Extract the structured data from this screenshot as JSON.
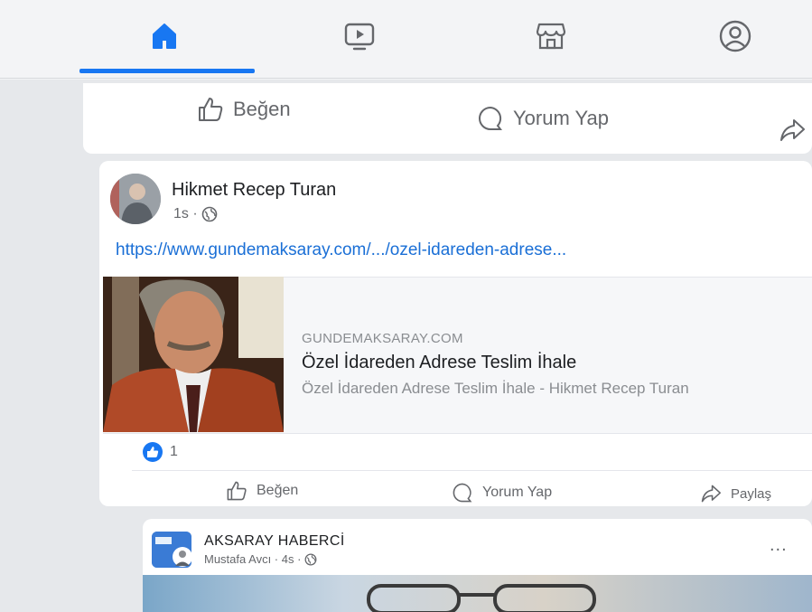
{
  "nav": {
    "tabs": [
      {
        "name": "home",
        "icon": "home-icon",
        "active": true
      },
      {
        "name": "watch",
        "icon": "video-icon",
        "active": false
      },
      {
        "name": "marketplace",
        "icon": "store-icon",
        "active": false
      },
      {
        "name": "profile",
        "icon": "profile-icon",
        "active": false
      }
    ],
    "accent_color": "#1877f2"
  },
  "top_actions": {
    "like_label": "Beğen",
    "comment_label": "Yorum Yap"
  },
  "post": {
    "author": "Hikmet Recep Turan",
    "time": "1s ·",
    "url_text": "https://www.gundemaksaray.com/.../ozel-idareden-adrese...",
    "preview": {
      "domain": "GUNDEMAKSARAY.COM",
      "title": "Özel İdareden Adrese Teslim İhale",
      "description": "Özel İdareden Adrese Teslim İhale - Hikmet Recep Turan"
    },
    "reaction_count": "1",
    "actions": {
      "like_label": "Beğen",
      "comment_label": "Yorum Yap",
      "share_label": "Paylaş"
    }
  },
  "next_post": {
    "page_name": "AKSARAY HABERCİ",
    "subtitle": "Mustafa Avcı · 4s ·",
    "more_label": "..."
  }
}
